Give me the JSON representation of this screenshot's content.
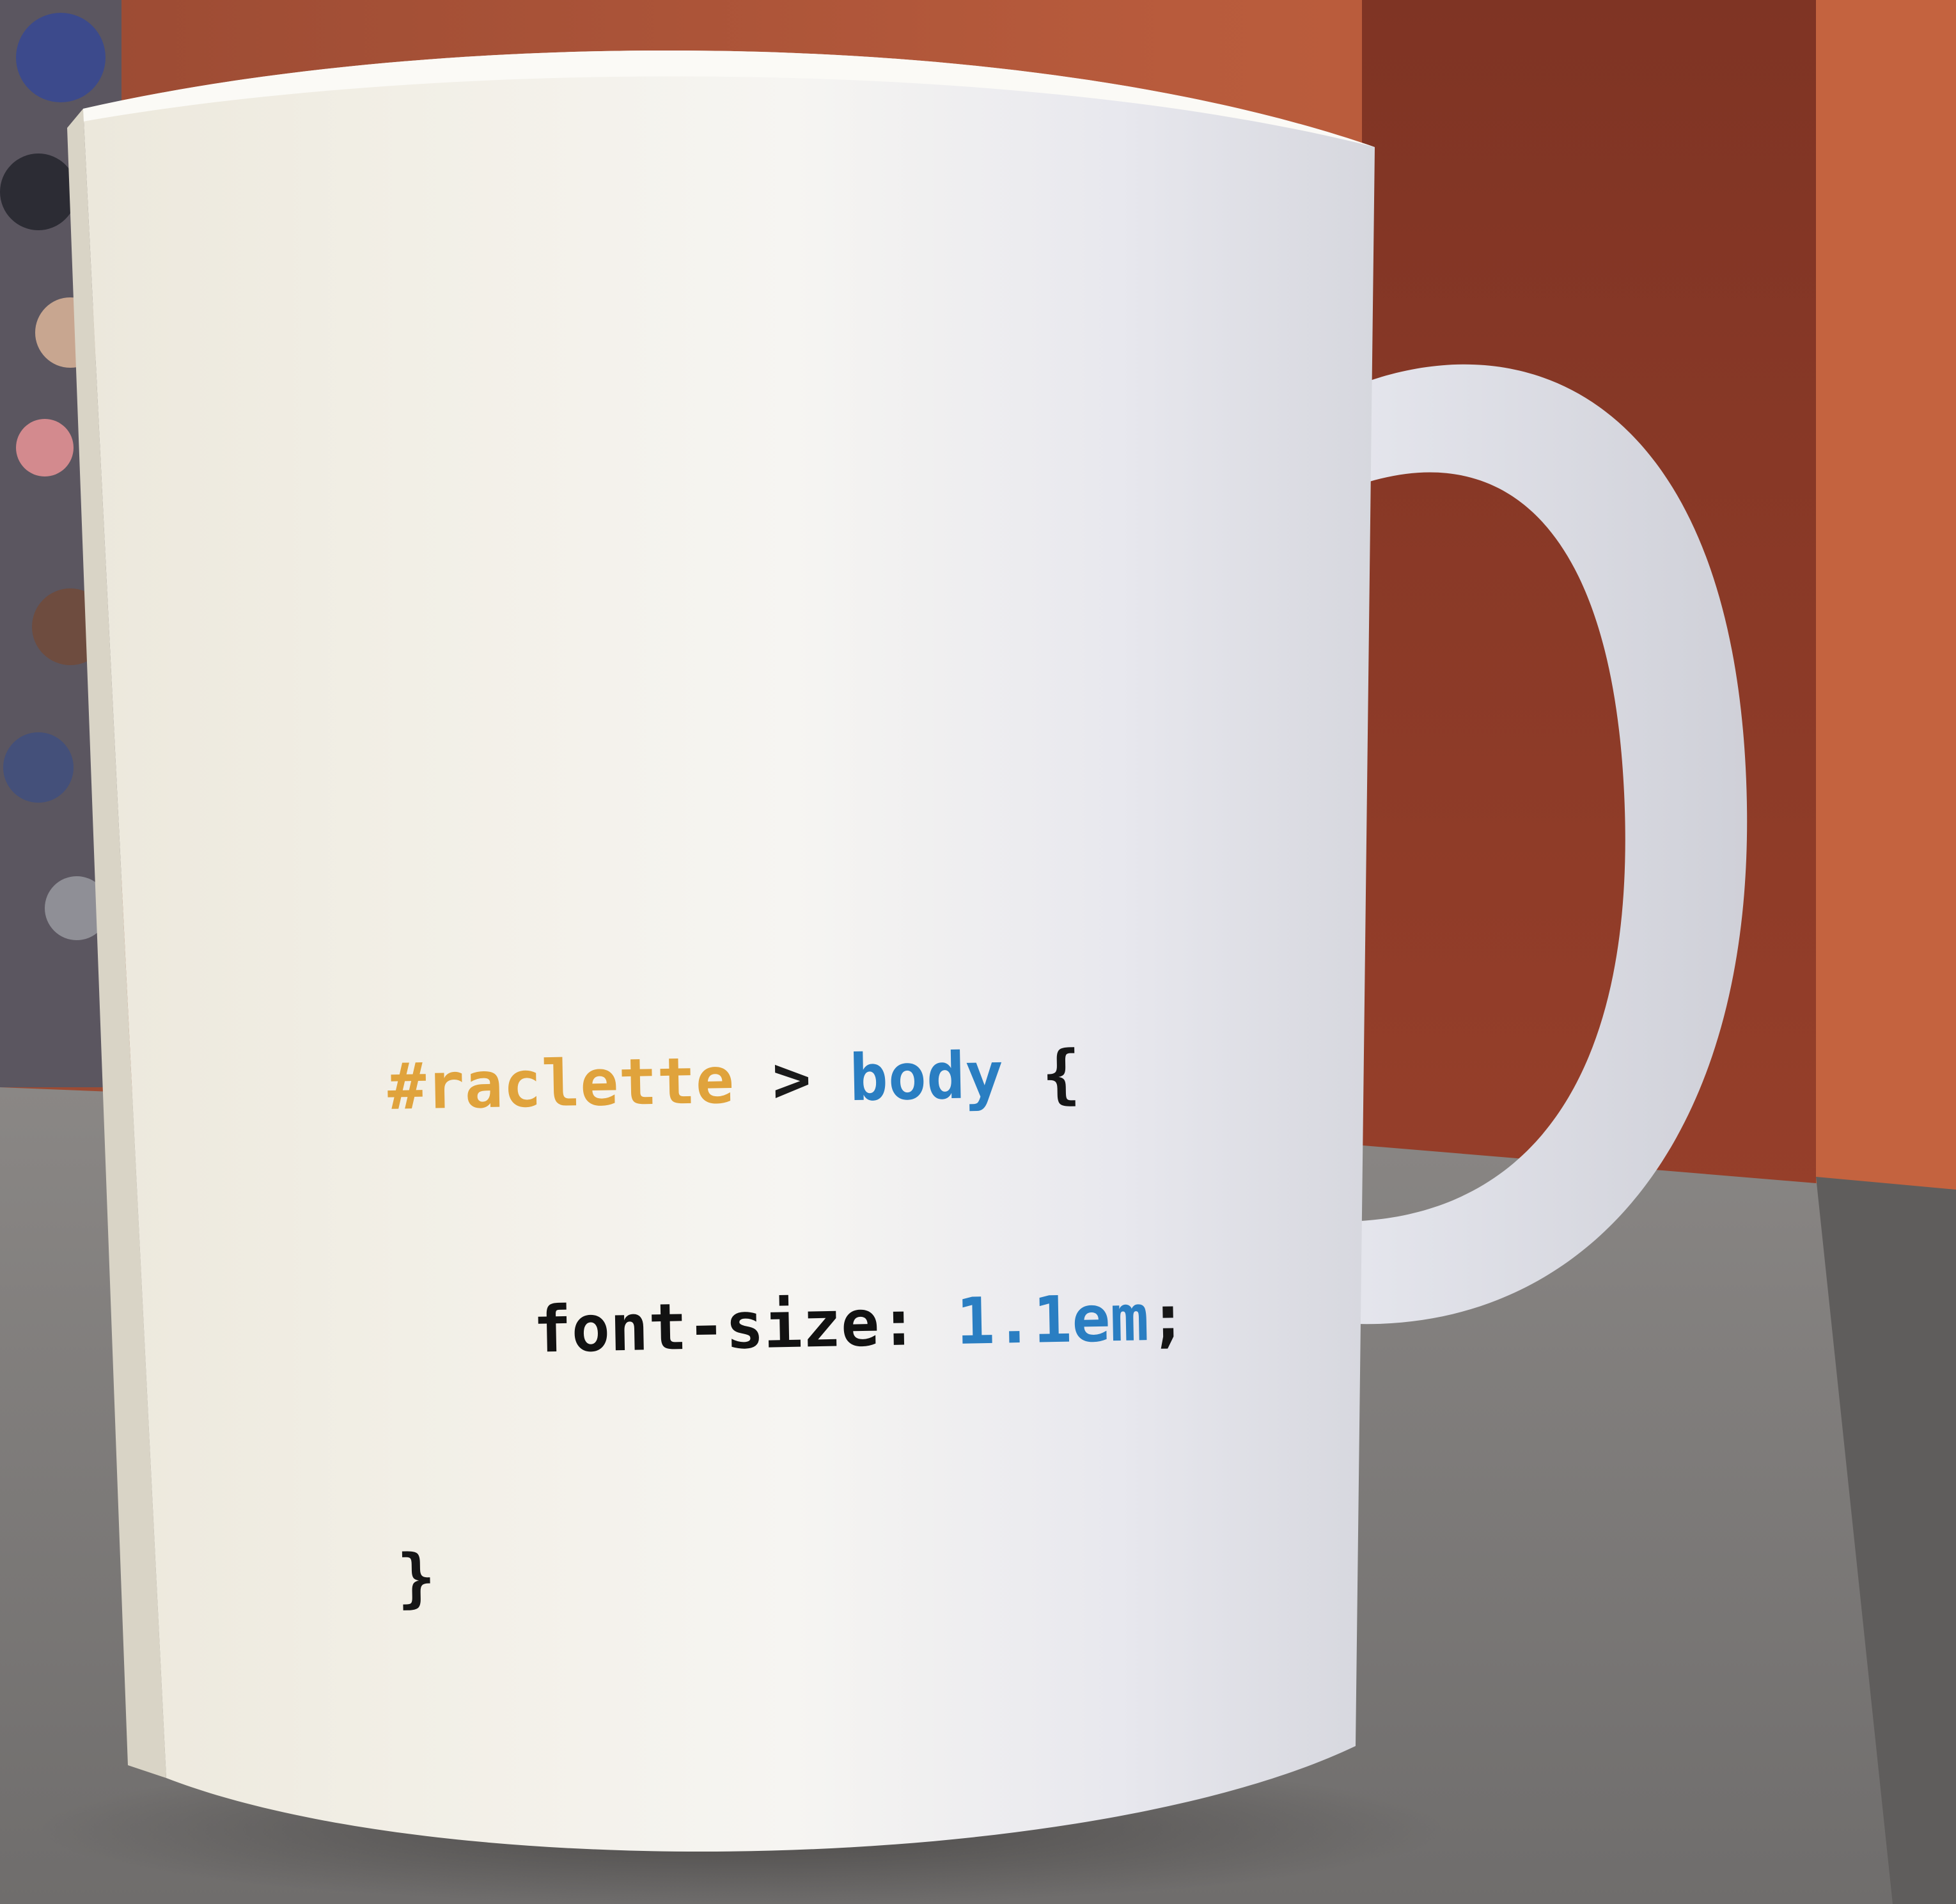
{
  "photo": {
    "subject": "mug",
    "colors": {
      "wall": "#b4583a",
      "cabinet": "#8e3d29",
      "surface": "#7c7977",
      "mug": "#ece9e6",
      "selector": "#e0a33c",
      "element": "#2a7ec2",
      "value": "#2a7ec2",
      "text": "#161616"
    }
  },
  "mug_print": {
    "line1": {
      "selector": "#raclette",
      "combinator": ">",
      "element": "body",
      "open_brace": "{"
    },
    "line2": {
      "property": "font-size:",
      "value": "1.1em",
      "semicolon": ";"
    },
    "line3": {
      "close_brace": "}"
    }
  }
}
